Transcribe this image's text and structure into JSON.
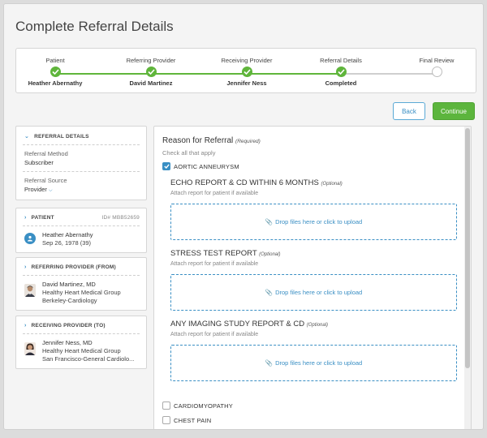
{
  "page": {
    "title": "Complete Referral Details"
  },
  "stepper": {
    "steps": [
      {
        "label": "Patient",
        "value": "Heather Abernathy",
        "done": true
      },
      {
        "label": "Referring Provider",
        "value": "David Martinez",
        "done": true
      },
      {
        "label": "Receiving Provider",
        "value": "Jennifer Ness",
        "done": true
      },
      {
        "label": "Referral Details",
        "value": "Completed",
        "done": true
      },
      {
        "label": "Final Review",
        "value": "",
        "done": false
      }
    ]
  },
  "actions": {
    "back_label": "Back",
    "continue_label": "Continue"
  },
  "colors": {
    "accent_blue": "#3a8fc4",
    "success_green": "#5cb53d"
  },
  "sidebar": {
    "referral_details": {
      "heading": "REFERRAL DETAILS",
      "method_label": "Referral Method",
      "method_value": "Subscriber",
      "source_label": "Referral Source",
      "source_value": "Provider"
    },
    "patient": {
      "heading": "PATIENT",
      "id": "ID# MBB52659",
      "name": "Heather Abernathy",
      "dob": "Sep 26, 1978 (39)"
    },
    "referring": {
      "heading": "REFERRING PROVIDER (FROM)",
      "name": "David Martinez, MD",
      "org": "Healthy Heart Medical Group",
      "location": "Berkeley-Cardiology"
    },
    "receiving": {
      "heading": "RECEIVING PROVIDER (TO)",
      "name": "Jennifer Ness, MD",
      "org": "Healthy Heart Medical Group",
      "location": "San Francisco-General Cardiolo..."
    }
  },
  "main": {
    "title": "Reason for Referral",
    "required": "(Required)",
    "subtitle": "Check all that apply",
    "reasons": [
      {
        "label": "AORTIC ANNEURYSM",
        "checked": true
      },
      {
        "label": "CARDIOMYOPATHY",
        "checked": false
      },
      {
        "label": "CHEST PAIN",
        "checked": false
      }
    ],
    "reports": [
      {
        "title": "ECHO REPORT & CD WITHIN 6 MONTHS",
        "optional": "(Optional)",
        "hint": "Attach report for patient if available",
        "drop": "Drop files here or click to upload"
      },
      {
        "title": "STRESS TEST REPORT",
        "optional": "(Optional)",
        "hint": "Attach report for patient if available",
        "drop": "Drop files here or click to upload"
      },
      {
        "title": "ANY IMAGING STUDY REPORT & CD",
        "optional": "(Optional)",
        "hint": "Attach report for patient if available",
        "drop": "Drop files here or click to upload"
      }
    ]
  }
}
